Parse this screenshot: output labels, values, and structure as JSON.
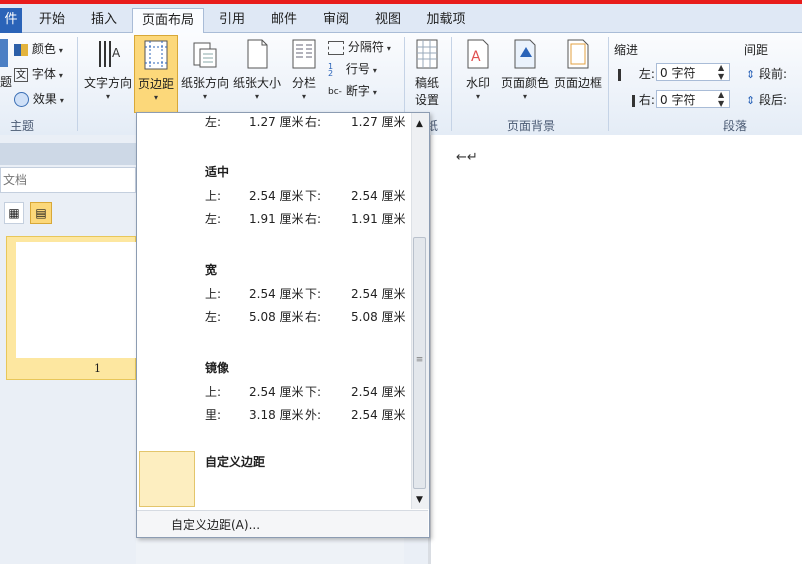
{
  "tabs": [
    {
      "label": "件",
      "kind": "file"
    },
    {
      "label": "开始"
    },
    {
      "label": "插入"
    },
    {
      "label": "页面布局",
      "active": true
    },
    {
      "label": "引用"
    },
    {
      "label": "邮件"
    },
    {
      "label": "审阅"
    },
    {
      "label": "视图"
    },
    {
      "label": "加载项"
    }
  ],
  "ribbon": {
    "theme_group": {
      "label": "主题",
      "colors": "颜色",
      "fonts": "字体",
      "effects": "效果",
      "cut_char": "题"
    },
    "page_setup": {
      "text_direction": "文字方向",
      "margins": "页边距",
      "orientation": "纸张方向",
      "size": "纸张大小",
      "columns": "分栏",
      "breaks": "分隔符",
      "line_numbers": "行号",
      "hyphenation": "断字"
    },
    "manuscript": {
      "label": "稿纸\n设置",
      "line1": "稿纸",
      "line2": "设置",
      "group_label": "纸"
    },
    "page_background": {
      "label": "页面背景",
      "watermark": "水印",
      "page_color": "页面颜色",
      "page_borders": "页面边框"
    },
    "paragraph": {
      "label": "段落",
      "indent": "缩进",
      "indent_left_label": "左:",
      "indent_left_value": "0 字符",
      "indent_right_label": "右:",
      "indent_right_value": "0 字符",
      "spacing": "间距",
      "spacing_before": "段前:",
      "spacing_after": "段后:"
    }
  },
  "left_panel": {
    "search_text": "文档",
    "page_number": "1"
  },
  "margins_menu": {
    "top_partial": {
      "left_label": "左:",
      "left_value": "1.27 厘米",
      "right_label": "右:",
      "right_value": "1.27 厘米"
    },
    "presets": [
      {
        "name": "适中",
        "r1": [
          "上:",
          "2.54 厘米",
          "下:",
          "2.54 厘米"
        ],
        "r2": [
          "左:",
          "1.91 厘米",
          "右:",
          "1.91 厘米"
        ]
      },
      {
        "name": "宽",
        "r1": [
          "上:",
          "2.54 厘米",
          "下:",
          "2.54 厘米"
        ],
        "r2": [
          "左:",
          "5.08 厘米",
          "右:",
          "5.08 厘米"
        ]
      },
      {
        "name": "镜像",
        "r1": [
          "上:",
          "2.54 厘米",
          "下:",
          "2.54 厘米"
        ],
        "r2": [
          "里:",
          "3.18 厘米",
          "外:",
          "2.54 厘米"
        ]
      }
    ],
    "custom_preset": "自定义边距",
    "custom_footer": "自定义边距(A)..."
  },
  "document": {
    "paragraph_mark": "↵"
  },
  "colors": {
    "accent_red": "#e81c1c",
    "file_tab": "#2a63b8",
    "highlight": "#fcd87a"
  }
}
